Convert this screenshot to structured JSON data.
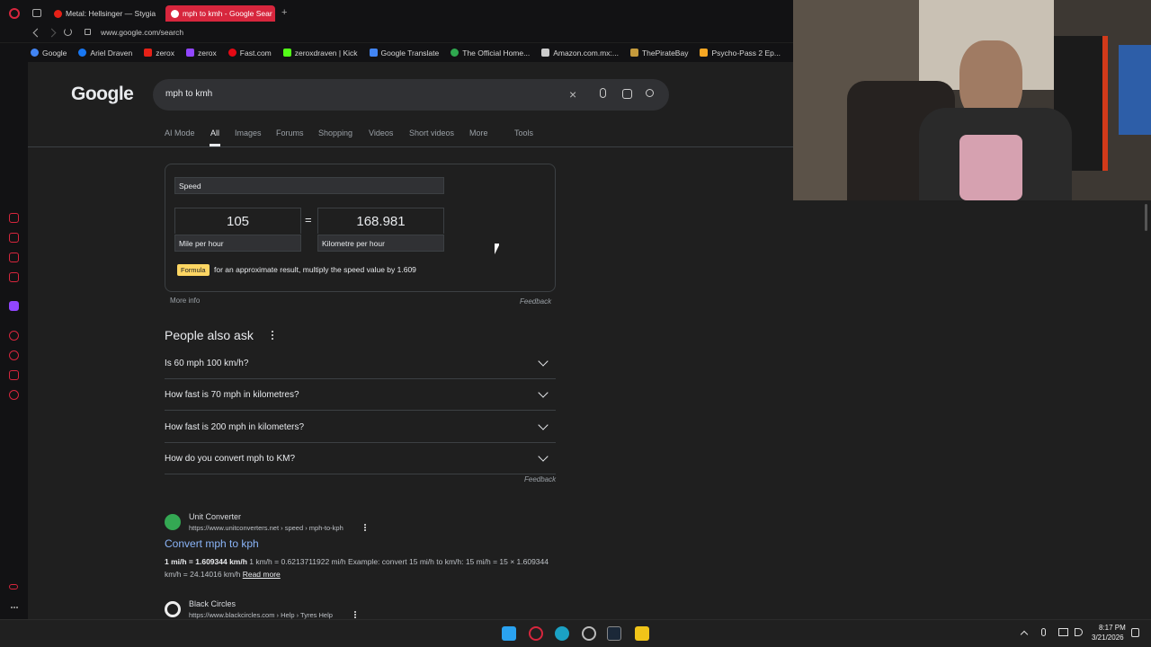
{
  "browser": {
    "tabs": [
      {
        "title": "Metal: Hellsinger — Stygia",
        "color": "#e62117"
      },
      {
        "title": "mph to kmh - Google Sear",
        "color": "#4285f4"
      }
    ],
    "new_tab": "+",
    "url": "www.google.com/search",
    "bookmarks": [
      {
        "label": "Google",
        "color": "#4285f4"
      },
      {
        "label": "Ariel Draven",
        "color": "#1877f2"
      },
      {
        "label": "zerox",
        "color": "#e62117"
      },
      {
        "label": "zerox",
        "color": "#9146ff"
      },
      {
        "label": "Fast.com",
        "color": "#e50914"
      },
      {
        "label": "zeroxdraven | Kick",
        "color": "#53fc18"
      },
      {
        "label": "Google Translate",
        "color": "#4285f4"
      },
      {
        "label": "The Official Home...",
        "color": "#2fa84f"
      },
      {
        "label": "Amazon.com.mx:...",
        "color": "#cccccc"
      },
      {
        "label": "ThePirateBay",
        "color": "#c49a3c"
      },
      {
        "label": "Psycho-Pass 2 Ep...",
        "color": "#f5a623"
      }
    ]
  },
  "search": {
    "logo": "Google",
    "query": "mph to kmh"
  },
  "nav": {
    "items": [
      "AI Mode",
      "All",
      "Images",
      "Forums",
      "Shopping",
      "Videos",
      "Short videos",
      "More",
      "Tools"
    ],
    "active": "All"
  },
  "converter": {
    "category": "Speed",
    "from_value": "105",
    "to_value": "168.981",
    "equals": "=",
    "from_unit": "Mile per hour",
    "to_unit": "Kilometre per hour",
    "formula_badge": "Formula",
    "formula_text": "for an approximate result, multiply the speed value by 1.609",
    "more_info": "More info",
    "feedback": "Feedback"
  },
  "paa": {
    "title": "People also ask",
    "questions": [
      "Is 60 mph 100 km/h?",
      "How fast is 70 mph in kilometres?",
      "How fast is 200 mph in kilometers?",
      "How do you convert mph to KM?"
    ],
    "feedback": "Feedback"
  },
  "results": [
    {
      "site": "Unit Converter",
      "url": "https://www.unitconverters.net › speed › mph-to-kph",
      "title": "Convert mph to kph",
      "snippet_bold": "1 mi/h = 1.609344 km/h",
      "snippet": " 1 km/h = 0.6213711922 mi/h Example: convert 15 mi/h to km/h: 15 mi/h = 15 × 1.609344 km/h = 24.14016 km/h",
      "read_more": "Read more"
    },
    {
      "site": "Black Circles",
      "url": "https://www.blackcircles.com › Help › Tyres Help"
    }
  ],
  "taskbar": {
    "time": "8:17 PM",
    "date": "3/21/2026"
  }
}
